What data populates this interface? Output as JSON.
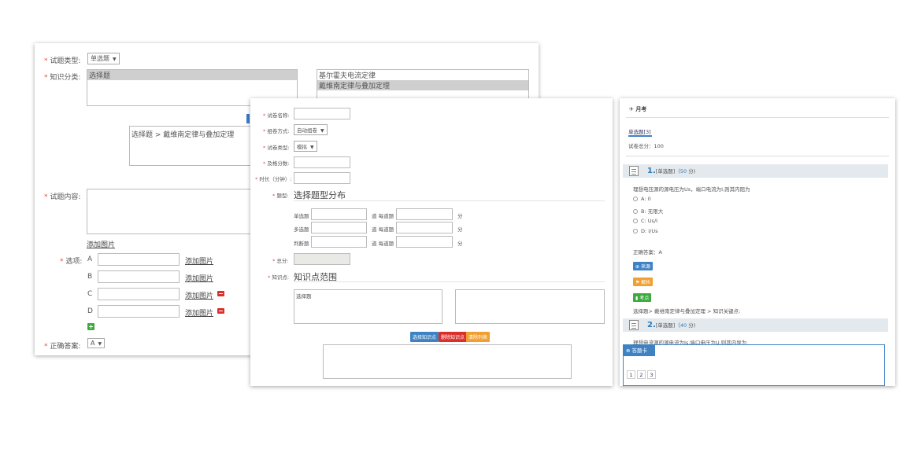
{
  "panel1": {
    "type_label": "试题类型:",
    "type_value": "单选题",
    "knowledge_label": "知识分类:",
    "knowledge_left_item": "选择题",
    "knowledge_right_items": [
      "基尔霍夫电流定律",
      "戴维南定律与叠加定理"
    ],
    "path_text": "选择题 > 戴维南定律与叠加定理",
    "content_label": "试题内容:",
    "add_image": "添加图片",
    "options_label": "选项:",
    "options": [
      {
        "letter": "A",
        "add_image": "添加图片"
      },
      {
        "letter": "B",
        "add_image": "添加图片"
      },
      {
        "letter": "C",
        "add_image": "添加图片"
      },
      {
        "letter": "D",
        "add_image": "添加图片"
      }
    ],
    "answer_label": "正确答案:",
    "answer_value": "A"
  },
  "panel2": {
    "name_label": "试卷名称:",
    "compose_label": "组卷方式:",
    "compose_value": "自动组卷",
    "paper_type_label": "试卷类型:",
    "paper_type_value": "模拟",
    "pass_label": "及格分数:",
    "duration_label": "时长（分钟）:",
    "question_type_label": "题型:",
    "question_type_title": "选择题型分布",
    "rows": [
      {
        "label": "单选题",
        "per": "道 每道题",
        "unit": "分"
      },
      {
        "label": "多选题",
        "per": "道 每道题",
        "unit": "分"
      },
      {
        "label": "判断题",
        "per": "道 每道题",
        "unit": "分"
      }
    ],
    "total_label": "总分:",
    "knowledge_label": "知识点:",
    "knowledge_title": "知识点范围",
    "knowledge_item": "选择题",
    "btn_select": "选择知识点",
    "btn_delete": "删除知识点",
    "btn_clear": "清除列表"
  },
  "panel3": {
    "title": "月考",
    "tab": "单选题[3]",
    "total_score": "试卷总分：100",
    "q1": {
      "num": "1.",
      "meta": "[单选题]（",
      "score": "50",
      "meta_end": "分)",
      "text": "理想电压源的源电压为Us，端口电流为I,则其内阻为",
      "options": [
        "A: 0",
        "B: 无限大",
        "C: Us/I",
        "D: I/Us"
      ],
      "answer": "正确答案：A",
      "tag_source": "来源",
      "tag_analysis": "解析",
      "tag_points": "考点",
      "path": "选择题> 戴维南定律与叠加定理 > 知识关键点:"
    },
    "q2": {
      "num": "2.",
      "meta": "[单选题]（",
      "score": "40",
      "meta_end": "分)",
      "text": "理想电流源的源电流为Is,端口电压为U,则其内导为"
    },
    "answer_card_title": "答题卡",
    "pages": [
      "1",
      "2",
      "3"
    ]
  }
}
